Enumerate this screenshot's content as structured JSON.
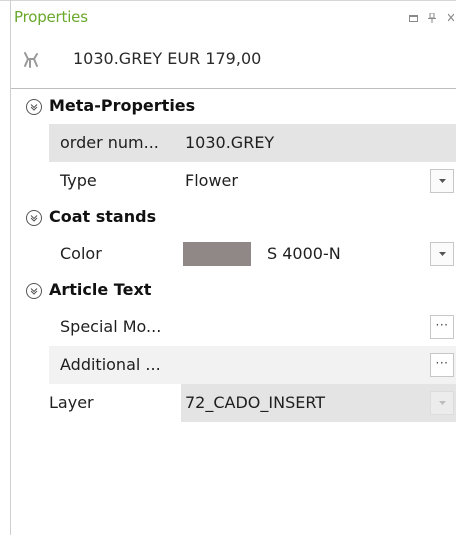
{
  "panel": {
    "title": "Properties",
    "selection": "1030.GREY EUR 179,00"
  },
  "colors": {
    "title": "#69a82b",
    "swatch": "#8f8886"
  },
  "grid": {
    "meta": {
      "label": "Meta-Properties",
      "order_name": "order num...",
      "order_value": "1030.GREY",
      "type_name": "Type",
      "type_value": "Flower"
    },
    "coat": {
      "label": "Coat stands",
      "color_name": "Color",
      "color_value": "S 4000-N"
    },
    "article": {
      "label": "Article Text",
      "special_name": "Special Mo...",
      "additional_name": "Additional ..."
    },
    "layer": {
      "name": "Layer",
      "value": "72_CADO_INSERT"
    },
    "ellipsis": "···"
  }
}
